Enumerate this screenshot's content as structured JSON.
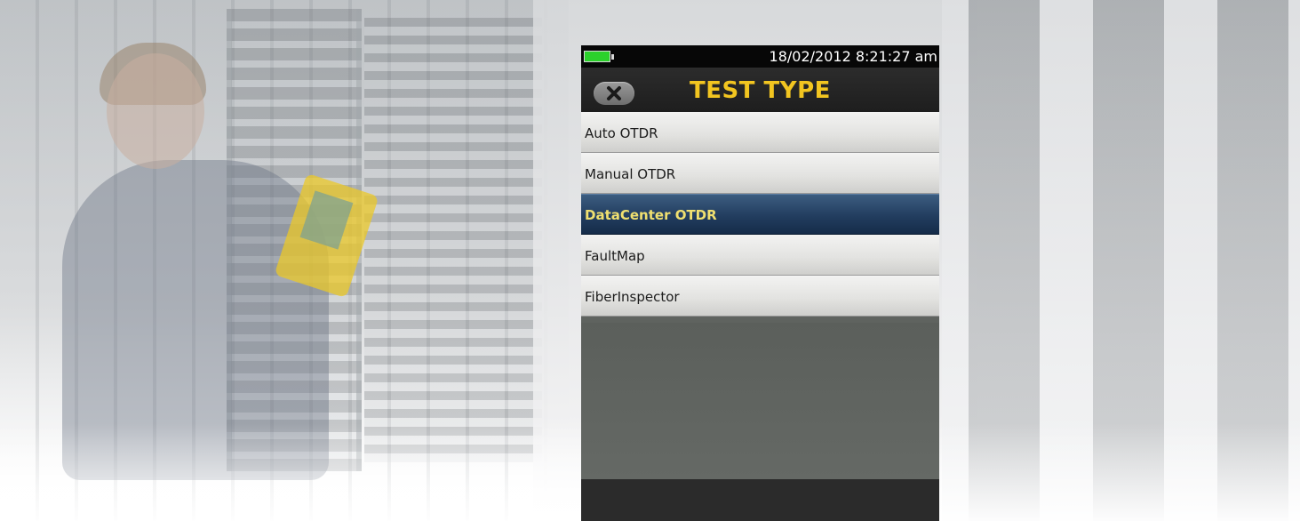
{
  "statusbar": {
    "datetime": "18/02/2012 8:21:27 am",
    "battery_color": "#2bd12b"
  },
  "header": {
    "title": "TEST TYPE",
    "back_icon": "close-x-icon"
  },
  "menu": {
    "items": [
      {
        "label": "Auto OTDR",
        "selected": false
      },
      {
        "label": "Manual OTDR",
        "selected": false
      },
      {
        "label": "DataCenter OTDR",
        "selected": true
      },
      {
        "label": "FaultMap",
        "selected": false
      },
      {
        "label": "FiberInspector",
        "selected": false
      }
    ]
  },
  "colors": {
    "title": "#f2c520",
    "selected_bg": "#223d5f",
    "selected_text": "#f0e070"
  }
}
